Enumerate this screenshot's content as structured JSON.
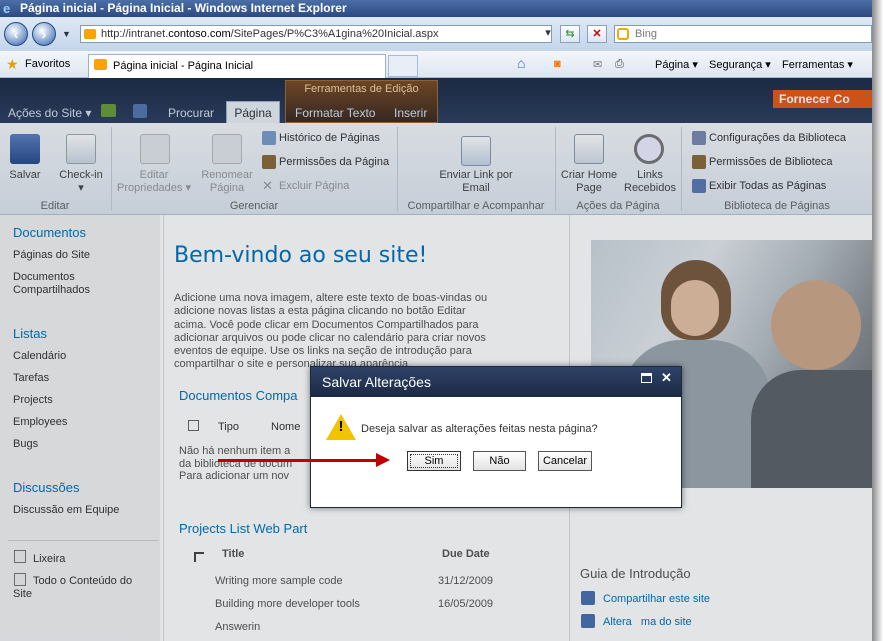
{
  "browser": {
    "title": "Página inicial - Página Inicial - Windows Internet Explorer",
    "url_prefix": "http://intranet.",
    "url_host": "contoso.com",
    "url_path": "/SitePages/P%C3%A1gina%20Inicial.aspx",
    "search_placeholder": "Bing",
    "favorites_label": "Favoritos",
    "tab_title": "Página inicial - Página Inicial",
    "cmd_pagina": "Página",
    "cmd_seguranca": "Segurança",
    "cmd_ferramentas": "Ferramentas"
  },
  "ribbon": {
    "context_group": "Ferramentas de Edição",
    "site_actions": "Ações do Site",
    "tabs": [
      "Procurar",
      "Página",
      "Formatar Texto",
      "Inserir"
    ],
    "fornecer": "Fornecer Co",
    "buttons": {
      "salvar": "Salvar",
      "checkin": "Check-in",
      "editar1": "Editar",
      "editar2": "Propriedades",
      "renomear1": "Renomear",
      "renomear2": "Página",
      "historico": "Histórico de Páginas",
      "permissoes": "Permissões da Página",
      "excluir": "Excluir Página",
      "email1": "Enviar Link por",
      "email2": "Email",
      "criar1": "Criar Home",
      "criar2": "Page",
      "links1": "Links",
      "links2": "Recebidos",
      "config_bib": "Configurações da Biblioteca",
      "perm_bib": "Permissões de Biblioteca",
      "exibir": "Exibir Todas as Páginas"
    },
    "groups": {
      "editar": "Editar",
      "gerenciar": "Gerenciar",
      "compartilhar": "Compartilhar e Acompanhar",
      "acoes": "Ações da Página",
      "biblioteca": "Biblioteca de Páginas"
    }
  },
  "nav": {
    "documentos": "Documentos",
    "paginas_site": "Páginas do Site",
    "docs_comp1": "Documentos",
    "docs_comp2": "Compartilhados",
    "listas": "Listas",
    "calendario": "Calendário",
    "tarefas": "Tarefas",
    "projects": "Projects",
    "employees": "Employees",
    "bugs": "Bugs",
    "discussoes": "Discussões",
    "discussao_equipe": "Discussão em Equipe",
    "lixeira": "Lixeira",
    "todo1": "Todo o Conteúdo do",
    "todo2": "Site"
  },
  "content": {
    "welcome": "Bem-vindo ao seu site!",
    "intro_lines": [
      "Adicione uma nova imagem, altere este texto de boas-vindas ou",
      "adicione novas listas a esta página clicando no botão Editar",
      "acima. Você pode clicar em Documentos Compartilhados para",
      "adicionar arquivos ou pode clicar no calendário para criar novos",
      "eventos de equipe. Use os links na seção de introdução para",
      "compartilhar o site e personalizar sua aparência."
    ],
    "docs_title": "Documentos Compa",
    "col_tipo": "Tipo",
    "col_nome": "Nome",
    "empty1": "Não há nenhum item a",
    "empty2": "da biblioteca de docum",
    "empty3": "Para adicionar um nov",
    "projects_title": "Projects List Web Part",
    "col_title": "Title",
    "col_due": "Due Date",
    "rows": [
      {
        "title": "Writing more sample code",
        "due": "31/12/2009"
      },
      {
        "title": "Building more developer tools",
        "due": "16/05/2009"
      },
      {
        "title": "Answerin",
        "due": ""
      }
    ],
    "guia": "Guia de Introdução",
    "compartilhar": "Compartilhar este site",
    "alterar": "Altera   ma do site"
  },
  "dialog": {
    "title": "Salvar Alterações",
    "message": "Deseja salvar as alterações feitas nesta página?",
    "sim": "Sim",
    "nao": "Não",
    "cancelar": "Cancelar"
  }
}
